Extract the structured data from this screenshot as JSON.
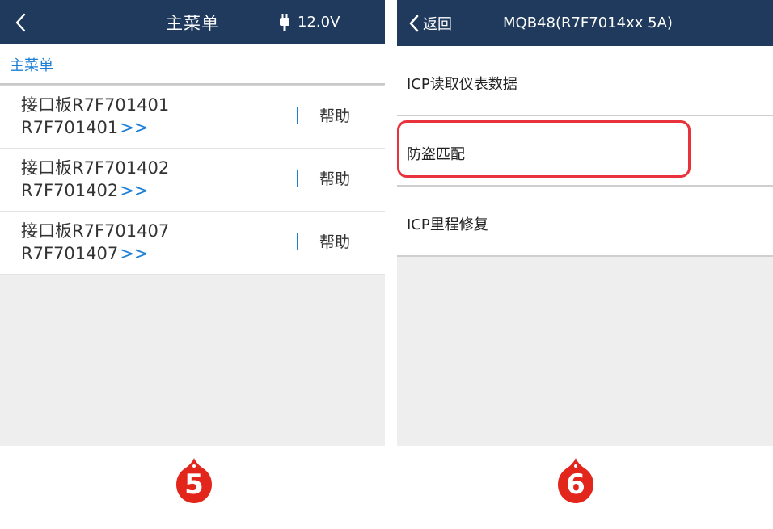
{
  "left_screen": {
    "header": {
      "title": "主菜单",
      "battery_icon": "plug-icon",
      "voltage": "12.0V"
    },
    "breadcrumb": "主菜单",
    "items": [
      {
        "line1": "接口板R7F701401",
        "line2": "R7F701401",
        "arrow": ">>",
        "help": "帮助"
      },
      {
        "line1": "接口板R7F701402",
        "line2": "R7F701402",
        "arrow": ">>",
        "help": "帮助"
      },
      {
        "line1": "接口板R7F701407",
        "line2": "R7F701407",
        "arrow": ">>",
        "help": "帮助"
      }
    ],
    "step_badge": "5"
  },
  "right_screen": {
    "header": {
      "back_label": "返回",
      "title": "MQB48(R7F7014xx 5A)"
    },
    "menu": [
      {
        "label": "ICP读取仪表数据"
      },
      {
        "label": "防盗匹配",
        "highlighted": true
      },
      {
        "label": "ICP里程修复"
      }
    ],
    "step_badge": "6"
  },
  "colors": {
    "header_bg": "#1f3a5c",
    "accent_blue": "#1c7fd6",
    "highlight_red": "#e8323c",
    "badge_red": "#e3261b"
  }
}
